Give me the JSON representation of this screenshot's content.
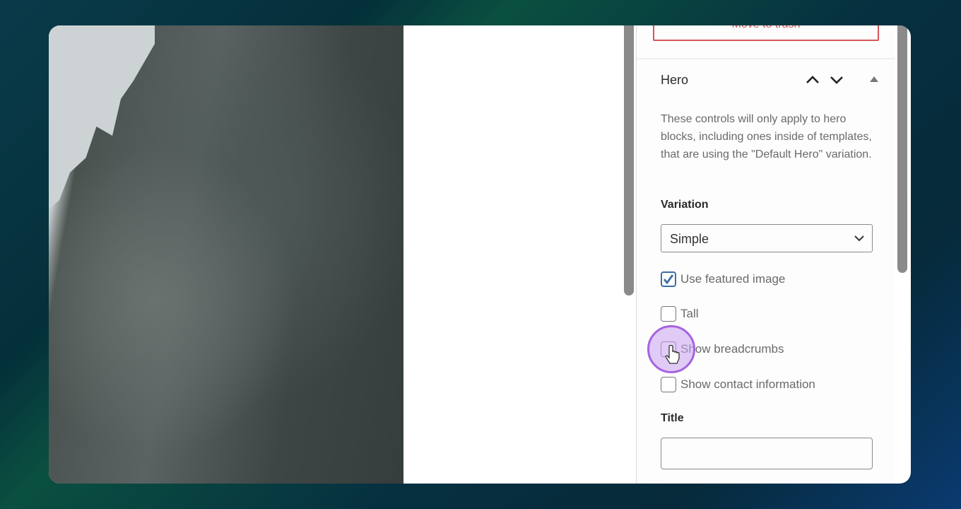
{
  "sidebar": {
    "trash_label": "Move to trash",
    "panel_title": "Hero",
    "description": "These controls will only apply to hero blocks, including ones inside of templates, that are using the \"Default Hero\" variation.",
    "variation_label": "Variation",
    "variation_value": "Simple",
    "checkboxes": [
      {
        "label": "Use featured image",
        "checked": true
      },
      {
        "label": "Tall",
        "checked": false
      },
      {
        "label": "Show breadcrumbs",
        "checked": false
      },
      {
        "label": "Show contact information",
        "checked": false
      }
    ],
    "title_label": "Title",
    "title_value": ""
  },
  "colors": {
    "danger": "#d6565c",
    "checkbox_accent": "#3b6ea5",
    "cursor_highlight": "#a663e0"
  }
}
